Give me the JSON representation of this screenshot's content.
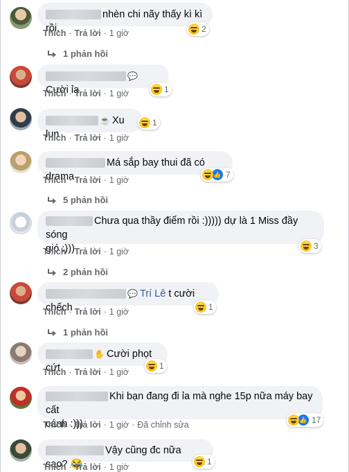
{
  "labels": {
    "like": "Thích",
    "reply": "Trả lời",
    "edited": "Đã chỉnh sửa"
  },
  "comments": [
    {
      "text": "nhèn chi nãy thấy kì kì rồi.",
      "time": "1 giờ",
      "reactions": "2",
      "replies": "1 phản hồi"
    },
    {
      "mention_icon": "messenger-icon",
      "text": "Cười ỉa",
      "time": "1 giờ",
      "reactions": "1"
    },
    {
      "mention_icon": "coffee-icon",
      "text": "Xu lun",
      "time": "1 giờ",
      "reactions": "1"
    },
    {
      "text": "Má sắp bay thui đã có drama",
      "time": "1 giờ",
      "reactions": "7",
      "replies": "5 phản hồi"
    },
    {
      "text_line1": "Chưa qua thầy điểm rồi :))))) dự là 1 Miss đầy sóng",
      "text_line2": "gió :)))",
      "time": "1 giờ",
      "reactions": "3",
      "replies": "2 phản hồi"
    },
    {
      "mention_icon": "messenger-icon",
      "tag": "Trí Lê",
      "text": " t cười chếch",
      "time": "1 giờ",
      "reactions": "1",
      "replies": "1 phản hồi"
    },
    {
      "mention_icon": "hand-icon",
      "text": "Cười phọt cứt",
      "time": "1 giờ",
      "reactions": "1"
    },
    {
      "text_line1": "Khi bạn đang đi ỉa mà nghe 15p nữa máy bay cất",
      "text_line2": "cánh :)))",
      "time": "1 giờ",
      "reactions": "17"
    },
    {
      "text": "Vậy cũng đc nữa sao? 😂",
      "time": "1 giờ",
      "reactions": "1"
    }
  ],
  "colors": {
    "bubble": "#f0f2f5",
    "meta": "#65676b",
    "link": "#385898"
  }
}
